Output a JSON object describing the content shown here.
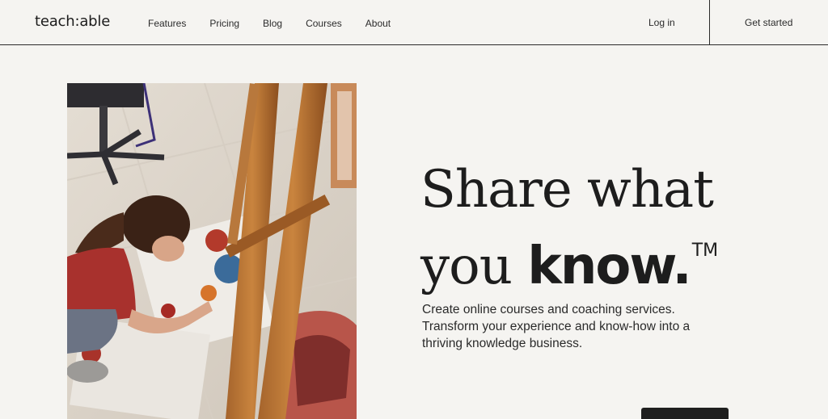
{
  "header": {
    "logo": "teach:able",
    "nav": [
      "Features",
      "Pricing",
      "Blog",
      "Courses",
      "About"
    ],
    "login": "Log in",
    "get_started": "Get started"
  },
  "hero": {
    "image_alt": "Artist painting on the floor next to an easel",
    "headline_line1": "Share what",
    "headline_line2_plain": "you ",
    "headline_line2_bold": "know.",
    "trademark": "TM",
    "subcopy": "Create online courses and coaching services. Transform your experience and know-how into a thriving knowledge business."
  },
  "colors": {
    "background": "#f5f4f1",
    "text": "#1d1d1d",
    "button": "#1f1f1f"
  }
}
